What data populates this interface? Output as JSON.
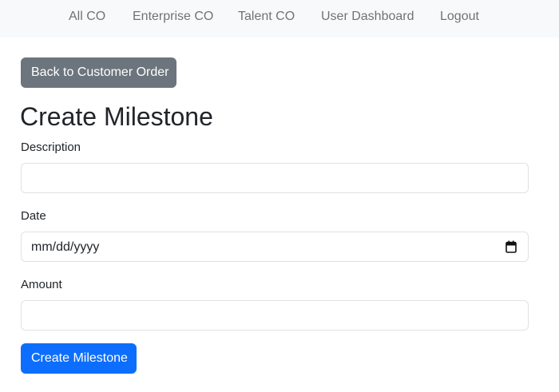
{
  "nav": {
    "items": [
      "All CO",
      "Enterprise CO",
      "Talent CO",
      "User Dashboard",
      "Logout"
    ]
  },
  "back_button": "Back to Customer Order",
  "title": "Create Milestone",
  "form": {
    "description": {
      "label": "Description",
      "value": ""
    },
    "date": {
      "label": "Date",
      "display": "mm/dd/yyyy",
      "icon": "calendar-icon"
    },
    "amount": {
      "label": "Amount",
      "value": ""
    },
    "submit": "Create Milestone"
  },
  "colors": {
    "navbar_bg": "#f8f9fa",
    "secondary_button": "#6c757d",
    "primary_button": "#0d6efd",
    "input_border": "#dee2e6",
    "text": "#212529"
  }
}
